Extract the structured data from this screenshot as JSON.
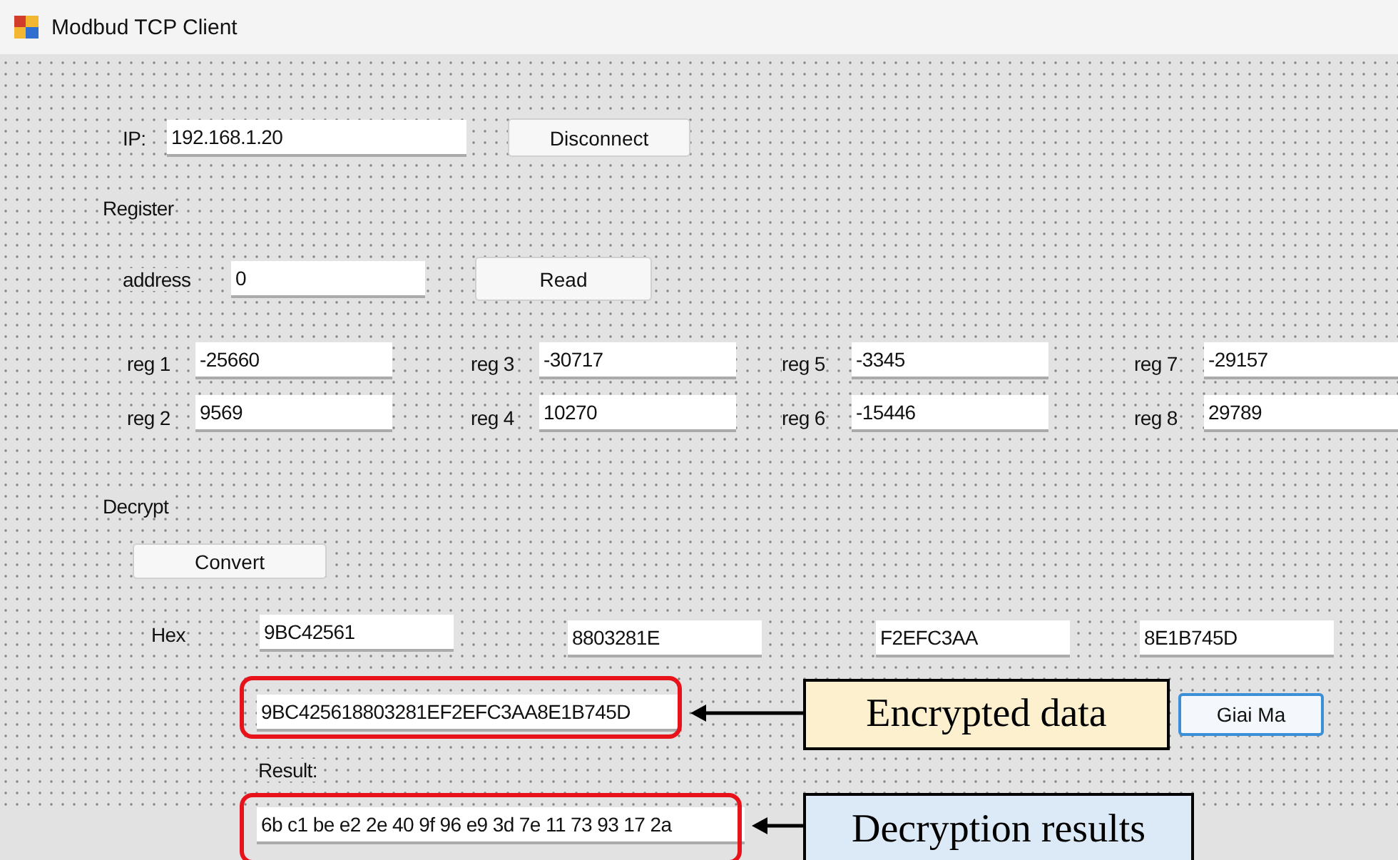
{
  "window": {
    "title": "Modbud TCP Client"
  },
  "connection": {
    "ip_label": "IP:",
    "ip_value": "192.168.1.20",
    "button": "Disconnect"
  },
  "register": {
    "heading": "Register",
    "address_label": "address",
    "address_value": "0",
    "button": "Read",
    "registers": [
      {
        "label": "reg 1",
        "value": "-25660"
      },
      {
        "label": "reg 2",
        "value": "9569"
      },
      {
        "label": "reg 3",
        "value": "-30717"
      },
      {
        "label": "reg 4",
        "value": "10270"
      },
      {
        "label": "reg 5",
        "value": "-3345"
      },
      {
        "label": "reg 6",
        "value": "-15446"
      },
      {
        "label": "reg 7",
        "value": "-29157"
      },
      {
        "label": "reg 8",
        "value": "29789"
      }
    ]
  },
  "decrypt": {
    "heading": "Decrypt",
    "button": "Convert",
    "hex_label": "Hex",
    "hex_values": [
      "9BC42561",
      "8803281E",
      "F2EFC3AA",
      "8E1B745D"
    ],
    "encrypted_value": "9BC425618803281EF2EFC3AA8E1B745D",
    "decode_button": "Giai Ma",
    "result_label": "Result:",
    "result_value": "6b c1 be e2 2e 40 9f 96 e9 3d 7e 11 73 93 17 2a"
  },
  "annotations": [
    {
      "text": "Encrypted data",
      "color": "#fdf0cf"
    },
    {
      "text": "Decryption results",
      "color": "#dce9f6"
    }
  ]
}
